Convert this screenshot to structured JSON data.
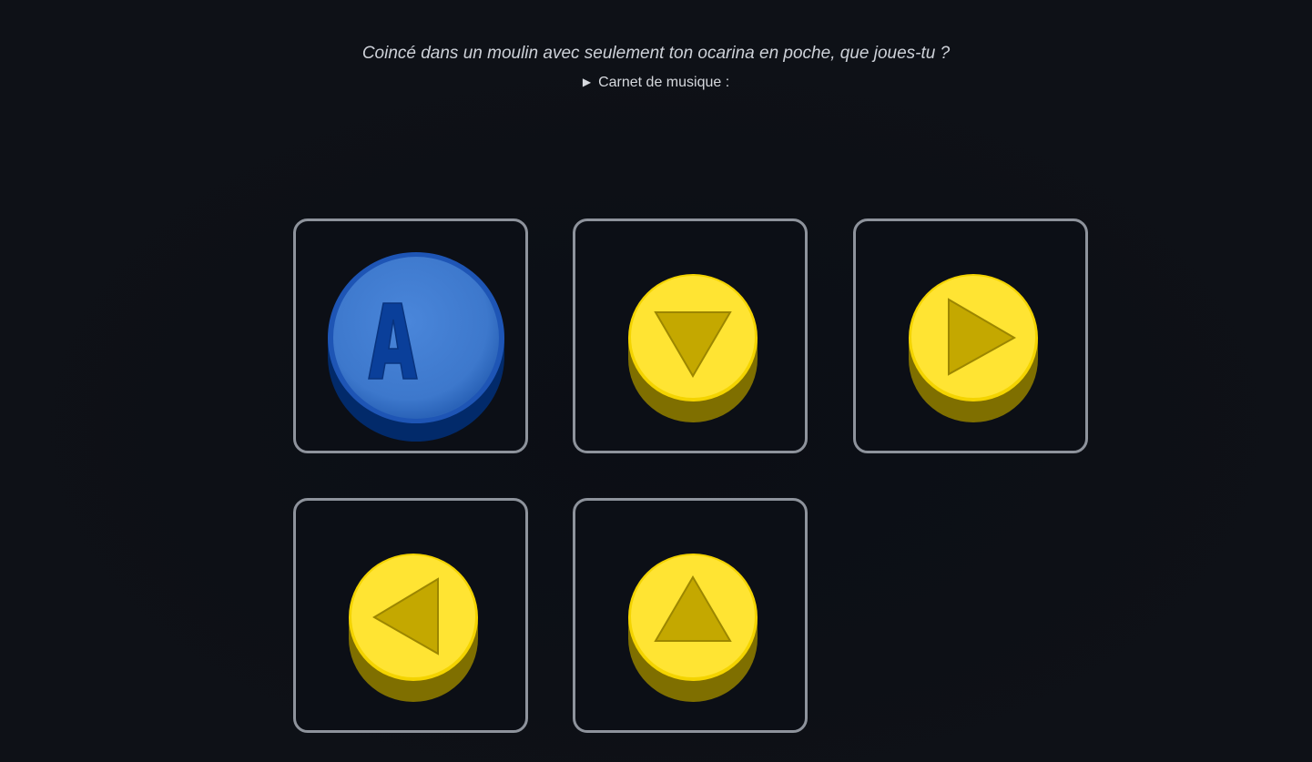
{
  "prompt": {
    "question": "Coincé dans un moulin avec seulement ton ocarina en poche, que joues-tu ?",
    "notebook_label": "Carnet de musique :",
    "notebook_toggle_icon": "disclosure-triangle-icon"
  },
  "buttons": [
    {
      "name": "a-button",
      "icon": "a-letter-icon",
      "label": "A",
      "color": "#3f7bd1"
    },
    {
      "name": "c-down-button",
      "icon": "arrow-down-icon",
      "color": "#ffe433"
    },
    {
      "name": "c-right-button",
      "icon": "arrow-right-icon",
      "color": "#ffe433"
    },
    {
      "name": "c-left-button",
      "icon": "arrow-left-icon",
      "color": "#ffe433"
    },
    {
      "name": "c-up-button",
      "icon": "arrow-up-icon",
      "color": "#ffe433"
    }
  ],
  "colors": {
    "background": "#0d1016",
    "tile_border": "#8e939c",
    "yellow_top": "#ffe433",
    "yellow_side": "#7f6f00",
    "yellow_arrow": "#c4a800",
    "blue_top": "#3f7bd1",
    "blue_side": "#022a6a",
    "blue_letter": "#0a3f9a"
  }
}
